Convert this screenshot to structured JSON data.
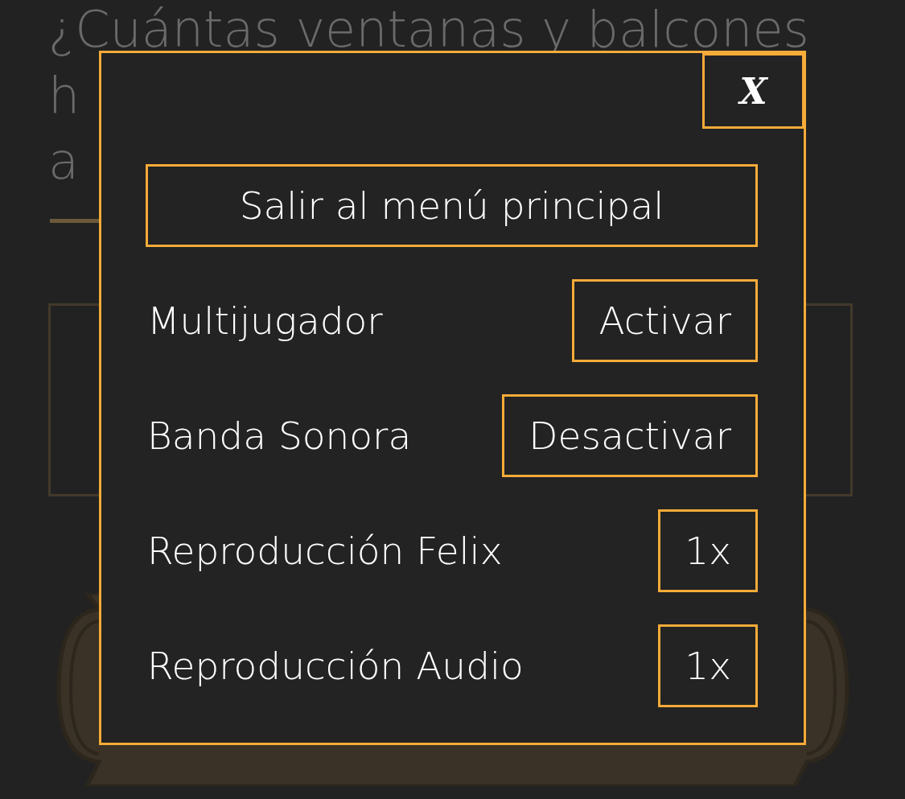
{
  "background": {
    "question_lines": [
      "¿Cuántas ventanas y balcones",
      "h",
      "a"
    ]
  },
  "dialog": {
    "close": "X",
    "main_button": "Salir al menú principal",
    "rows": [
      {
        "label": "Multijugador",
        "button": "Activar"
      },
      {
        "label": "Banda Sonora",
        "button": "Desactivar"
      },
      {
        "label": "Reproducción Felix",
        "button": "1x"
      },
      {
        "label": "Reproducción Audio",
        "button": "1x"
      }
    ]
  }
}
